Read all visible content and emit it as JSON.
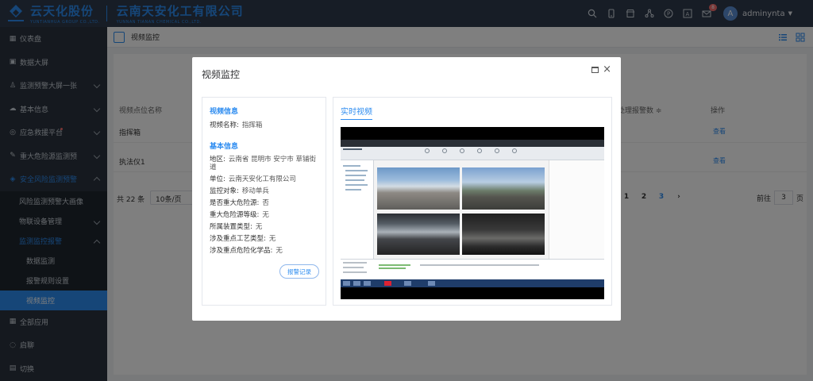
{
  "header": {
    "logo_cn": "云天化股份",
    "logo_en": "YUNTIANHUA GROUP CO.,LTD.",
    "company_cn": "云南天安化工有限公司",
    "company_en": "YUNNAN TIANAN CHEMICAL CO.,LTD.",
    "notification_count": "8",
    "avatar_letter": "A",
    "username": "adminynta",
    "icons": [
      "search-icon",
      "mobile-icon",
      "store-icon",
      "share-icon",
      "pay-icon",
      "font-icon",
      "mail-icon"
    ]
  },
  "sidebar": {
    "items": [
      {
        "label": "仪表盘",
        "icon": "dashboard-icon"
      },
      {
        "label": "数据大屏",
        "icon": "screen-icon"
      },
      {
        "label": "监测预警大屏一张",
        "icon": "user-icon"
      },
      {
        "label": "基本信息",
        "icon": "cloud-icon"
      },
      {
        "label": "应急救援平台",
        "icon": "rescue-icon"
      },
      {
        "label": "重大危险源监测预",
        "icon": "hazard-icon"
      },
      {
        "label": "安全风险监测预警",
        "icon": "shield-icon"
      }
    ],
    "sub_items": [
      {
        "label": "风险监测预警大画像"
      },
      {
        "label": "物联设备管理"
      },
      {
        "label": "监测监控报警"
      }
    ],
    "third_items": [
      {
        "label": "数据监测"
      },
      {
        "label": "报警规则设置"
      },
      {
        "label": "视频监控"
      }
    ],
    "bottom_items": [
      {
        "label": "全部应用",
        "icon": "apps-icon"
      },
      {
        "label": "启聊",
        "icon": "chat-icon"
      },
      {
        "label": "切换",
        "icon": "switch-icon"
      }
    ]
  },
  "page": {
    "title": "视频监控"
  },
  "table": {
    "headers": [
      "视频点位名称",
      "处理报警数 ≑",
      "操作"
    ],
    "rows": [
      {
        "name": "指挥箱",
        "action": "查看"
      },
      {
        "name": "执法仪1",
        "action": "查看"
      }
    ]
  },
  "pagination": {
    "total": "共 22 条",
    "page_size": "10条/页",
    "pages": [
      "1",
      "2",
      "3"
    ],
    "current": "3",
    "jump_prefix": "前往",
    "jump_value": "3",
    "jump_suffix": "页"
  },
  "modal": {
    "title": "视频监控",
    "video_info_title": "视频信息",
    "video_name_label": "视频名称:",
    "video_name_value": "指挥箱",
    "basic_info_title": "基本信息",
    "fields": [
      {
        "label": "地区:",
        "value": "云南省 昆明市 安宁市 草铺街道"
      },
      {
        "label": "单位:",
        "value": "云南天安化工有限公司"
      },
      {
        "label": "监控对象:",
        "value": "移动单兵"
      },
      {
        "label": "是否重大危险源:",
        "value": "否"
      },
      {
        "label": "重大危险源等级:",
        "value": "无"
      },
      {
        "label": "所属装置类型:",
        "value": "无"
      },
      {
        "label": "涉及重点工艺类型:",
        "value": "无"
      },
      {
        "label": "涉及重点危险化学品:",
        "value": "无"
      }
    ],
    "alarm_button": "报警记录",
    "live_title": "实时视频"
  },
  "colors": {
    "accent": "#2d8cf0",
    "header_bg": "#2f3b4c",
    "sidebar_bg": "#2b333e",
    "badge": "#f56c6c"
  }
}
